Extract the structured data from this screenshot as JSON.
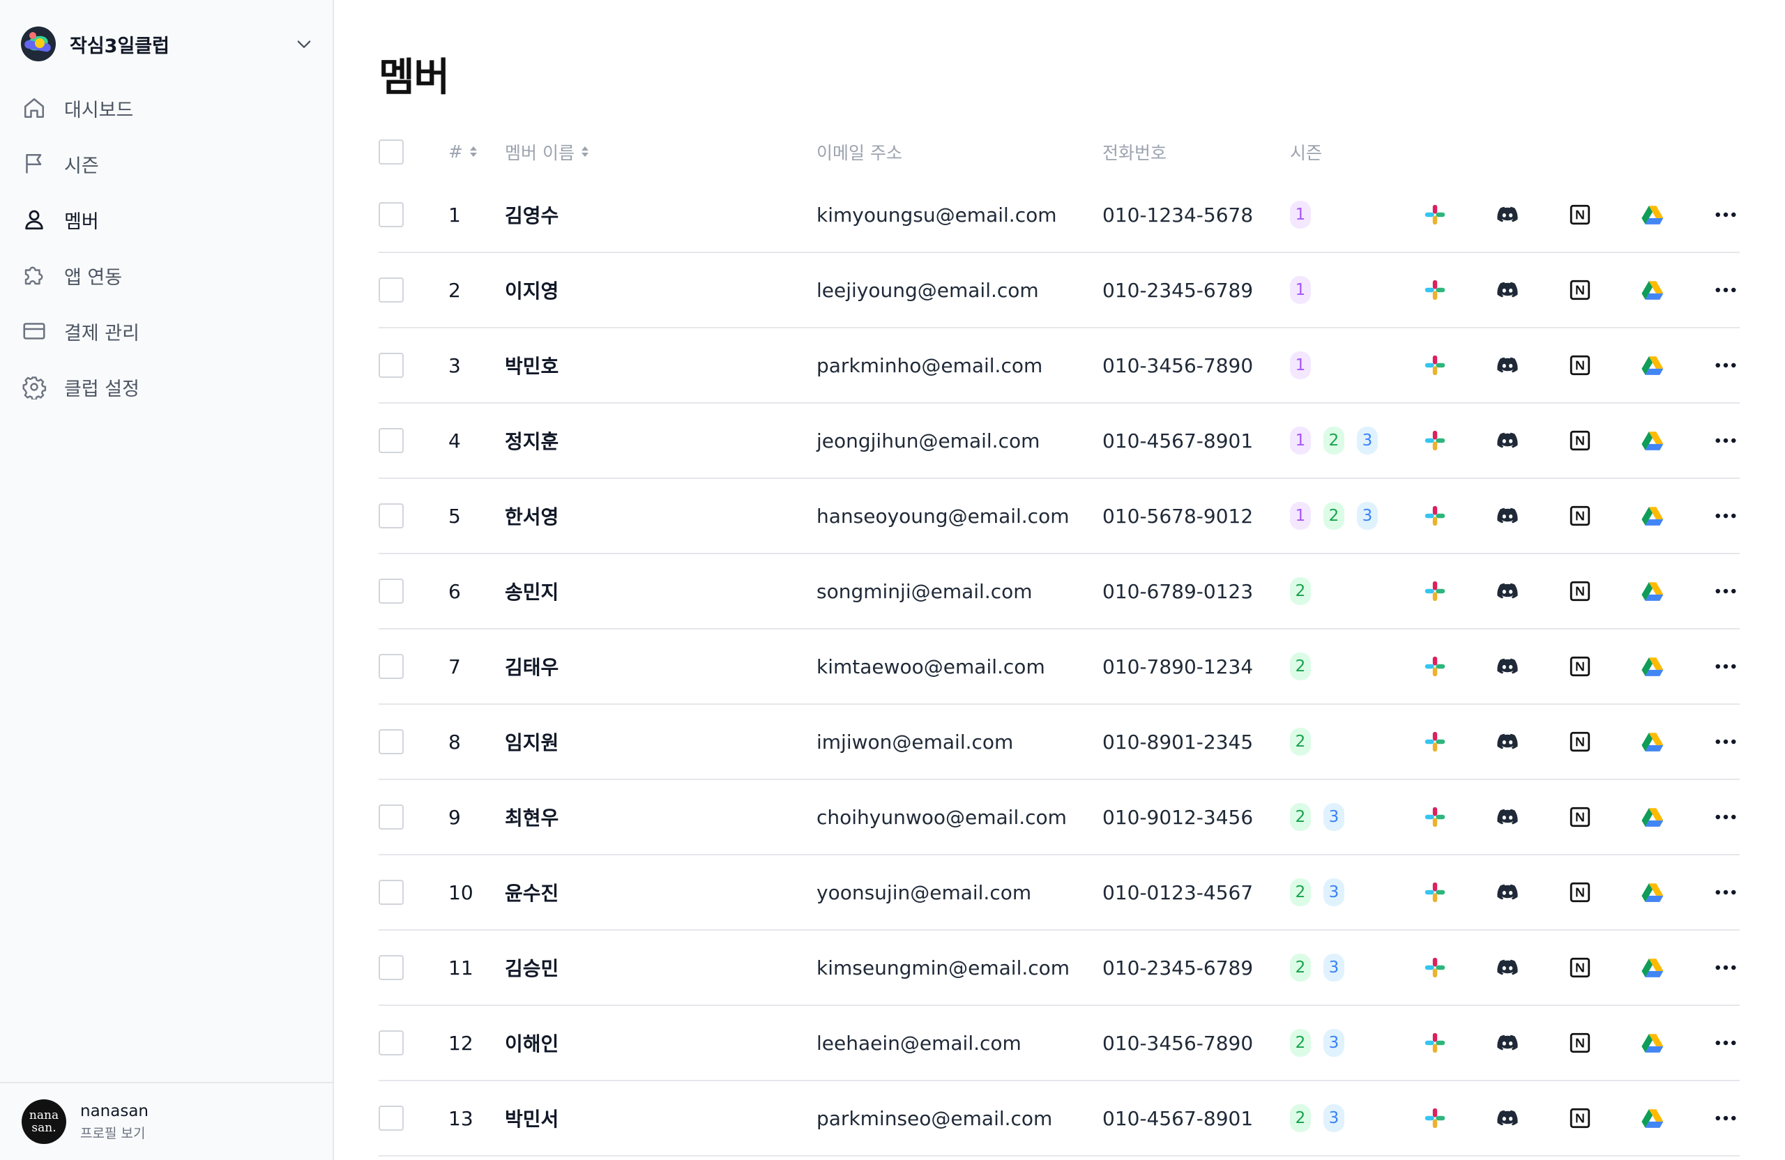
{
  "sidebar": {
    "club_name": "작심3일클럽",
    "items": [
      {
        "label": "대시보드",
        "icon": "home-icon",
        "active": false
      },
      {
        "label": "시즌",
        "icon": "flag-icon",
        "active": false
      },
      {
        "label": "멤버",
        "icon": "user-icon",
        "active": true
      },
      {
        "label": "앱 연동",
        "icon": "puzzle-icon",
        "active": false
      },
      {
        "label": "결제 관리",
        "icon": "credit-card-icon",
        "active": false
      },
      {
        "label": "클럽 설정",
        "icon": "gear-icon",
        "active": false
      }
    ],
    "profile": {
      "avatar_line1": "nana",
      "avatar_line2": "san.",
      "name": "nanasan",
      "link": "프로필 보기"
    }
  },
  "main": {
    "title": "멤버",
    "columns": {
      "num": "#",
      "name": "멤버 이름",
      "email": "이메일 주소",
      "phone": "전화번호",
      "season": "시즌"
    },
    "colors": {
      "season_1": "#a855f7",
      "season_2": "#16a34a",
      "season_3": "#3b82f6"
    },
    "members": [
      {
        "num": "1",
        "name": "김영수",
        "email": "kimyoungsu@email.com",
        "phone": "010-1234-5678",
        "seasons": [
          "1"
        ]
      },
      {
        "num": "2",
        "name": "이지영",
        "email": "leejiyoung@email.com",
        "phone": "010-2345-6789",
        "seasons": [
          "1"
        ]
      },
      {
        "num": "3",
        "name": "박민호",
        "email": "parkminho@email.com",
        "phone": "010-3456-7890",
        "seasons": [
          "1"
        ]
      },
      {
        "num": "4",
        "name": "정지훈",
        "email": "jeongjihun@email.com",
        "phone": "010-4567-8901",
        "seasons": [
          "1",
          "2",
          "3"
        ]
      },
      {
        "num": "5",
        "name": "한서영",
        "email": "hanseoyoung@email.com",
        "phone": "010-5678-9012",
        "seasons": [
          "1",
          "2",
          "3"
        ]
      },
      {
        "num": "6",
        "name": "송민지",
        "email": "songminji@email.com",
        "phone": "010-6789-0123",
        "seasons": [
          "2"
        ]
      },
      {
        "num": "7",
        "name": "김태우",
        "email": "kimtaewoo@email.com",
        "phone": "010-7890-1234",
        "seasons": [
          "2"
        ]
      },
      {
        "num": "8",
        "name": "임지원",
        "email": "imjiwon@email.com",
        "phone": "010-8901-2345",
        "seasons": [
          "2"
        ]
      },
      {
        "num": "9",
        "name": "최현우",
        "email": "choihyunwoo@email.com",
        "phone": "010-9012-3456",
        "seasons": [
          "2",
          "3"
        ]
      },
      {
        "num": "10",
        "name": "윤수진",
        "email": "yoonsujin@email.com",
        "phone": "010-0123-4567",
        "seasons": [
          "2",
          "3"
        ]
      },
      {
        "num": "11",
        "name": "김승민",
        "email": "kimseungmin@email.com",
        "phone": "010-2345-6789",
        "seasons": [
          "2",
          "3"
        ]
      },
      {
        "num": "12",
        "name": "이해인",
        "email": "leehaein@email.com",
        "phone": "010-3456-7890",
        "seasons": [
          "2",
          "3"
        ]
      },
      {
        "num": "13",
        "name": "박민서",
        "email": "parkminseo@email.com",
        "phone": "010-4567-8901",
        "seasons": [
          "2",
          "3"
        ]
      }
    ],
    "app_icons": [
      "slack-icon",
      "discord-icon",
      "notion-icon",
      "google-drive-icon"
    ]
  }
}
